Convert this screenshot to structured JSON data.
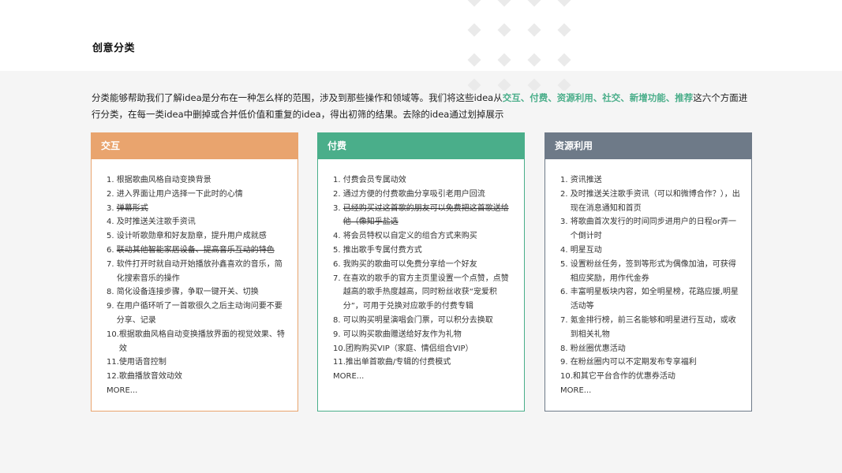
{
  "page": {
    "title": "创意分类"
  },
  "intro": {
    "part1": "分类能够帮助我们了解idea是分布在一种怎么样的范围，涉及到那些操作和领域等。我们将这些idea从",
    "highlight": "交互、付费、资源利用、社交、新增功能、推荐",
    "part2": "这六个方面进行分类，在每一类idea中删掉或合并低价值和重复的idea，得出初筛的结果。去除的idea通过划掉展示"
  },
  "colors": {
    "interaction": "#e9a46e",
    "payment": "#4aae8a",
    "resource": "#6e7a88",
    "highlight": "#4aae8a"
  },
  "cards": [
    {
      "title": "交互",
      "items": [
        {
          "num": "1. ",
          "text": "根据歌曲风格自动变换背景",
          "struck": false
        },
        {
          "num": "2. ",
          "text": "进入界面让用户选择一下此时的心情",
          "struck": false
        },
        {
          "num": "3. ",
          "text": "弹幕形式",
          "struck": true
        },
        {
          "num": "4. ",
          "text": "及时推送关注歌手资讯",
          "struck": false
        },
        {
          "num": "5. ",
          "text": "设计听歌勋章和好友励章，提升用户成就感",
          "struck": false
        },
        {
          "num": "6. ",
          "text": "联动其他智能家居设备、提高音乐互动的特色",
          "struck": true
        },
        {
          "num": "7. ",
          "text": "软件打开时就自动开始播放孙鑫喜欢的音乐，简化搜索音乐的操作",
          "struck": false
        },
        {
          "num": "8. ",
          "text": "简化设备连接步骤，争取一键开关、切换",
          "struck": false
        },
        {
          "num": "9. ",
          "text": "在用户循环听了一首歌很久之后主动询问要不要分享、记录",
          "struck": false
        },
        {
          "num": "10.",
          "text": "根据歌曲风格自动变换播放界面的视觉效果、特效",
          "struck": false
        },
        {
          "num": "11.",
          "text": "使用语音控制",
          "struck": false
        },
        {
          "num": "12.",
          "text": "歌曲播放音效动效",
          "struck": false
        }
      ],
      "more": "MORE..."
    },
    {
      "title": "付费",
      "items": [
        {
          "num": "1. ",
          "text": "付费会员专属动效",
          "struck": false
        },
        {
          "num": "2. ",
          "text": "通过方便的付费歌曲分享吸引老用户回流",
          "struck": false
        },
        {
          "num": "3. ",
          "text": "已经购买过这首歌的朋友可以免费把这首歌送给他（像知乎盐选",
          "struck": true
        },
        {
          "num": "4. ",
          "text": "将会员特权以自定义的组合方式来购买",
          "struck": false
        },
        {
          "num": "5. ",
          "text": "推出歌手专属付费方式",
          "struck": false
        },
        {
          "num": "6. ",
          "text": "我购买的歌曲可以免费分享给一个好友",
          "struck": false
        },
        {
          "num": "7. ",
          "text": "在喜欢的歌手的官方主页里设置一个点赞，点赞越高的歌手热度越高，同时粉丝收获“宠爱积分”，可用于兑换对应歌手的付费专辑",
          "struck": false
        },
        {
          "num": "8. ",
          "text": "可以购买明星演唱会门票，可以积分去换取",
          "struck": false
        },
        {
          "num": "9. ",
          "text": "可以购买歌曲赠送给好友作为礼物",
          "struck": false
        },
        {
          "num": "10.",
          "text": "团购购买VIP（家庭、情侣组合VIP）",
          "struck": false
        },
        {
          "num": "11.",
          "text": "推出单首歌曲/专辑的付费模式",
          "struck": false
        }
      ],
      "more": "MORE..."
    },
    {
      "title": "资源利用",
      "items": [
        {
          "num": "1. ",
          "text": "资讯推送",
          "struck": false
        },
        {
          "num": "2. ",
          "text": "及时推送关注歌手资讯（可以和微博合作？），出现在消息通知和首页",
          "struck": false
        },
        {
          "num": "3. ",
          "text": "将歌曲首次发行的时间同步进用户的日程or弄一个倒计时",
          "struck": false
        },
        {
          "num": "4. ",
          "text": "明星互动",
          "struck": false
        },
        {
          "num": "5. ",
          "text": "设置粉丝任务，签到等形式为偶像加油，可获得相应奖励，用作代金券",
          "struck": false
        },
        {
          "num": "6. ",
          "text": "丰富明星板块内容，如全明星榜，花路应援,明星活动等",
          "struck": false
        },
        {
          "num": "7. ",
          "text": "氪金排行榜，前三名能够和明星进行互动，或收到相关礼物",
          "struck": false
        },
        {
          "num": "8. ",
          "text": "粉丝圈优惠活动",
          "struck": false
        },
        {
          "num": "9. ",
          "text": "在粉丝圈内可以不定期发布专享福利",
          "struck": false
        },
        {
          "num": "10.",
          "text": "和其它平台合作的优惠券活动",
          "struck": false
        }
      ],
      "more": "MORE..."
    }
  ]
}
